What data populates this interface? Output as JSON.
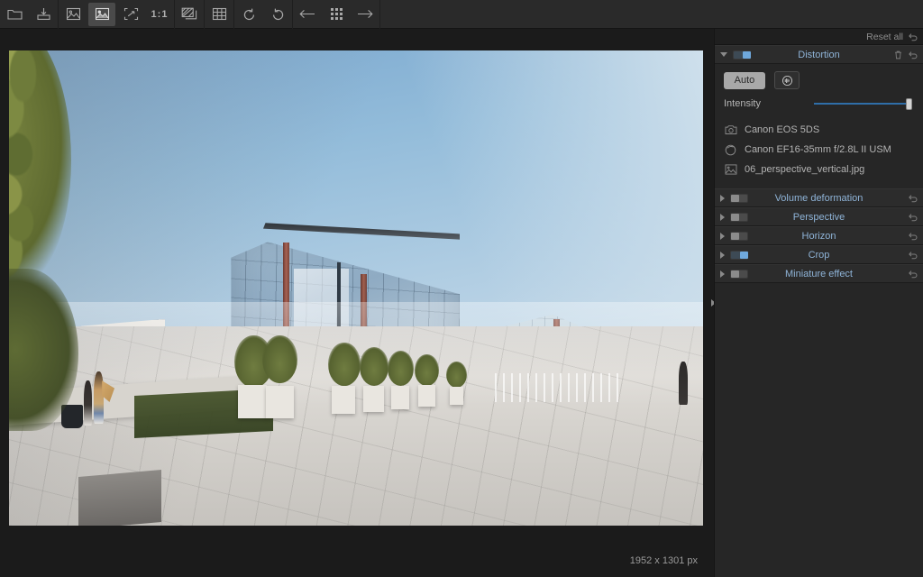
{
  "app": {
    "window_background": "#1b1b1b",
    "accent_blue": "#8fb4d8",
    "toggle_on_color": "#6fa9dd"
  },
  "toolbar": {
    "items": [
      {
        "name": "open-folder-icon",
        "icon": "folder",
        "label": "",
        "active": false
      },
      {
        "name": "export-icon",
        "icon": "export",
        "label": "",
        "active": false
      },
      {
        "name": "original-image-icon",
        "icon": "picture-outline",
        "label": "",
        "active": false
      },
      {
        "name": "edited-image-icon",
        "icon": "picture-filled",
        "label": "",
        "active": true
      },
      {
        "name": "fit-to-screen-icon",
        "icon": "fit",
        "label": "",
        "active": false
      },
      {
        "name": "zoom-one-to-one",
        "icon": "text",
        "label": "1:1",
        "active": false
      },
      {
        "name": "compare-split-icon",
        "icon": "compare",
        "label": "",
        "active": false
      },
      {
        "name": "grid-overlay-icon",
        "icon": "grid",
        "label": "",
        "active": false
      },
      {
        "name": "rotate-left-icon",
        "icon": "rotate-ccw",
        "label": "",
        "active": false
      },
      {
        "name": "rotate-right-icon",
        "icon": "rotate-cw",
        "label": "",
        "active": false
      },
      {
        "name": "previous-image-icon",
        "icon": "arrow-left",
        "label": "",
        "active": false
      },
      {
        "name": "thumbnails-icon",
        "icon": "dots-grid",
        "label": "",
        "active": false
      },
      {
        "name": "next-image-icon",
        "icon": "arrow-right",
        "label": "",
        "active": false
      }
    ]
  },
  "canvas": {
    "size_label": "1952 x 1301 px",
    "image_filename": "06_perspective_vertical.jpg"
  },
  "panel": {
    "reset_all_label": "Reset all",
    "distortion": {
      "title": "Distortion",
      "enabled": true,
      "expanded": true,
      "auto_button_label": "Auto",
      "lens_profile_button": "lens-profile-icon",
      "intensity_label": "Intensity",
      "intensity_value": 100,
      "camera": "Canon EOS 5DS",
      "lens": "Canon EF16-35mm f/2.8L II USM",
      "file": "06_perspective_vertical.jpg"
    },
    "sections": [
      {
        "title": "Volume deformation",
        "enabled": false,
        "expanded": false
      },
      {
        "title": "Perspective",
        "enabled": false,
        "expanded": false
      },
      {
        "title": "Horizon",
        "enabled": false,
        "expanded": false
      },
      {
        "title": "Crop",
        "enabled": true,
        "expanded": false
      },
      {
        "title": "Miniature effect",
        "enabled": false,
        "expanded": false
      }
    ]
  }
}
